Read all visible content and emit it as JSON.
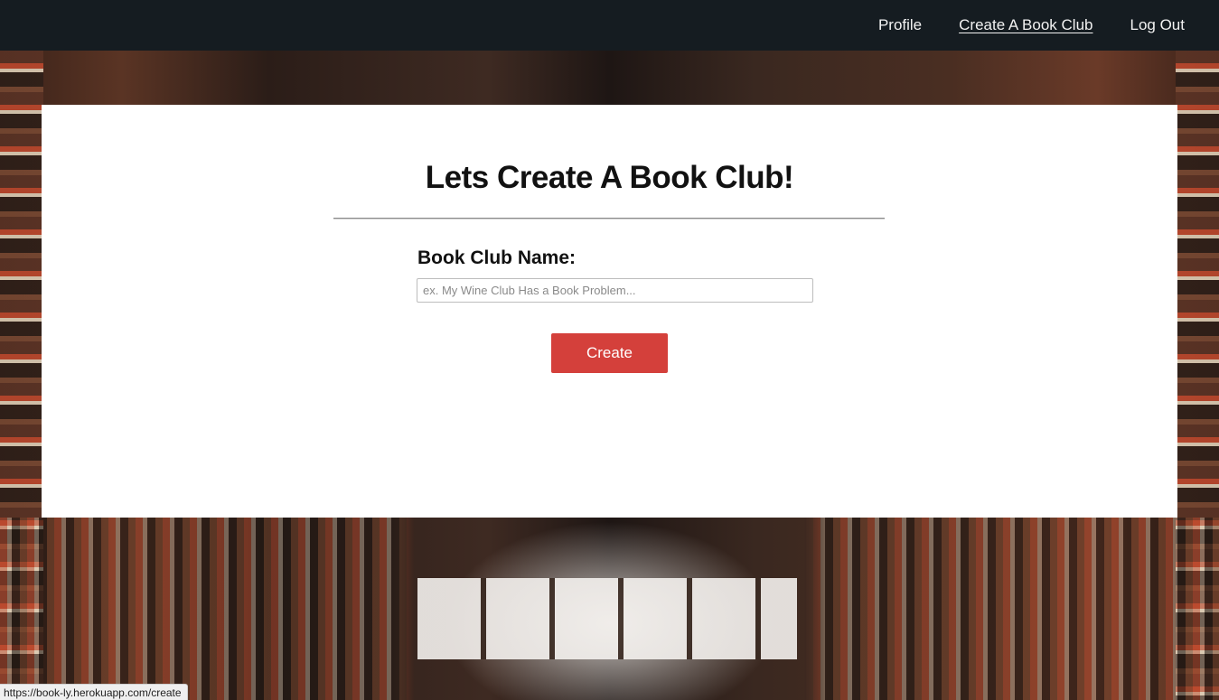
{
  "nav": {
    "items": [
      {
        "label": "Profile",
        "active": false
      },
      {
        "label": "Create A Book Club",
        "active": true
      },
      {
        "label": "Log Out",
        "active": false
      }
    ]
  },
  "main": {
    "title": "Lets Create A Book Club!",
    "field_label": "Book Club Name:",
    "input_value": "",
    "input_placeholder": "ex. My Wine Club Has a Book Problem...",
    "submit_label": "Create"
  },
  "status_bar": {
    "url": "https://book-ly.herokuapp.com/create"
  },
  "colors": {
    "navbar_bg": "#151c21",
    "button_bg": "#d4403b",
    "card_bg": "#ffffff"
  }
}
